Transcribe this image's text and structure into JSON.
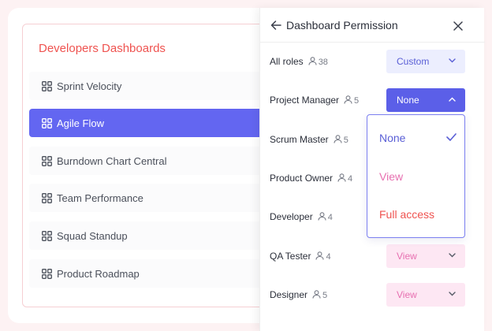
{
  "dashboards": {
    "title": "Developers Dashboards",
    "items": [
      {
        "label": "Sprint Velocity",
        "active": false
      },
      {
        "label": "Agile Flow",
        "active": true
      },
      {
        "label": "Burndown Chart Central",
        "active": false
      },
      {
        "label": "Team Performance",
        "active": false
      },
      {
        "label": "Squad Standup",
        "active": false
      },
      {
        "label": "Product Roadmap",
        "active": false
      }
    ]
  },
  "panel": {
    "title": "Dashboard Permission",
    "back_icon": "arrow-left-icon",
    "close_icon": "close-icon",
    "roles": [
      {
        "name": "All roles",
        "count": "38",
        "permission": "Custom"
      },
      {
        "name": "Project Manager",
        "count": "5",
        "permission": "None"
      },
      {
        "name": "Scrum Master",
        "count": "5",
        "permission": ""
      },
      {
        "name": "Product Owner",
        "count": "4",
        "permission": ""
      },
      {
        "name": "Developer",
        "count": "4",
        "permission": ""
      },
      {
        "name": "QA Tester",
        "count": "4",
        "permission": "View"
      },
      {
        "name": "Designer",
        "count": "5",
        "permission": "View"
      }
    ]
  },
  "dropdown": {
    "options": [
      {
        "label": "None",
        "selected": true,
        "color": "#5a5fd6"
      },
      {
        "label": "View",
        "selected": false,
        "color": "#e76fb0"
      },
      {
        "label": "Full access",
        "selected": false,
        "color": "#ef5350"
      }
    ]
  },
  "colors": {
    "accent": "#6366f1",
    "title_red": "#ef5350",
    "view_pink": "#e76fb0",
    "background": "#fdf2f3"
  }
}
